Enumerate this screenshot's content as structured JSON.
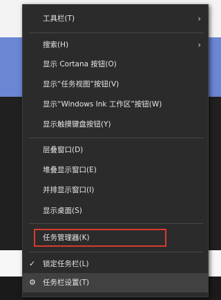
{
  "context_menu": {
    "items": [
      {
        "label": "工具栏(T)",
        "submenu_arrow": "›"
      },
      {
        "label": "搜索(H)",
        "submenu_arrow": "›"
      },
      {
        "label": "显示 Cortana 按钮(O)"
      },
      {
        "label": "显示“任务视图”按钮(V)"
      },
      {
        "label": "显示“Windows Ink 工作区”按钮(W)"
      },
      {
        "label": "显示触摸键盘按钮(Y)"
      },
      {
        "label": "层叠窗口(D)"
      },
      {
        "label": "堆叠显示窗口(E)"
      },
      {
        "label": "并排显示窗口(I)"
      },
      {
        "label": "显示桌面(S)"
      },
      {
        "label": "任务管理器(K)"
      },
      {
        "label": "锁定任务栏(L)",
        "icon": "checkmark-icon",
        "icon_glyph": "✓"
      },
      {
        "label": "任务栏设置(T)",
        "icon": "gear-icon",
        "icon_glyph": "⚙"
      }
    ]
  },
  "colors": {
    "menu_bg": "#2b2b2b",
    "highlight_border": "#d93a2e",
    "text": "#e6e6e6"
  }
}
